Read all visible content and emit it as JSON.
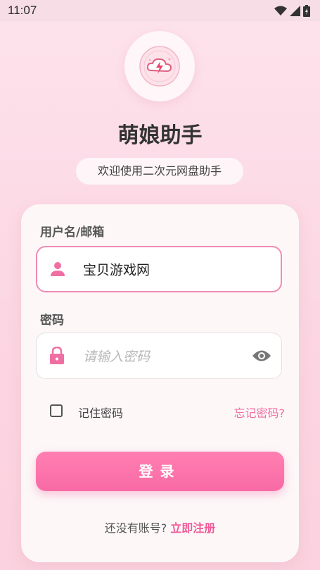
{
  "status_bar": {
    "time": "11:07"
  },
  "app": {
    "title": "萌娘助手",
    "subtitle": "欢迎使用二次元网盘助手"
  },
  "form": {
    "username_label": "用户名/邮箱",
    "username_value": "宝贝游戏网",
    "password_label": "密码",
    "password_placeholder": "请输入密码",
    "remember_label": "记住密码",
    "forgot_label": "忘记密码?",
    "login_label": "登录",
    "register_prompt": "还没有账号?",
    "register_link": "立即注册"
  },
  "colors": {
    "accent": "#f86aa4",
    "link": "#ef5c98",
    "background": "#fde3ec"
  },
  "icons": [
    "wifi-icon",
    "signal-icon",
    "battery-icon",
    "cloud-lightning-logo",
    "user-icon",
    "lock-icon",
    "eye-icon"
  ]
}
